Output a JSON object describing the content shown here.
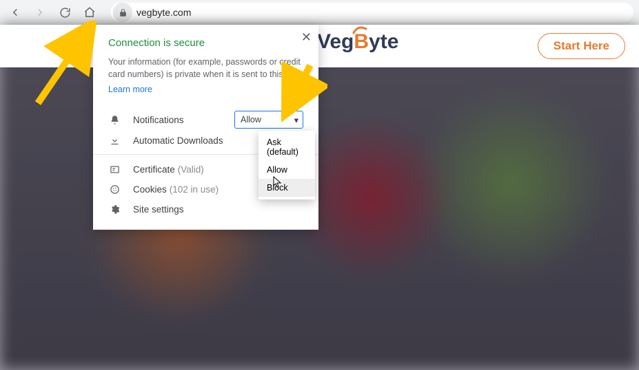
{
  "browser": {
    "url": "vegbyte.com"
  },
  "header": {
    "cta": "Start Here",
    "logo_main": "Veg",
    "logo_accent": "B",
    "logo_tail": "yte"
  },
  "popover": {
    "title": "Connection is secure",
    "desc": "Your information (for example, passwords or credit card numbers) is private when it is sent to this site.",
    "learn": "Learn more",
    "perm_notifications": "Notifications",
    "perm_notifications_value": "Allow",
    "perm_downloads": "Automatic Downloads",
    "certificate_label": "Certificate",
    "certificate_status": "(Valid)",
    "cookies_label": "Cookies",
    "cookies_count": "(102 in use)",
    "settings_label": "Site settings"
  },
  "dropdown": {
    "opt_ask": "Ask (default)",
    "opt_allow": "Allow",
    "opt_block": "Block"
  }
}
